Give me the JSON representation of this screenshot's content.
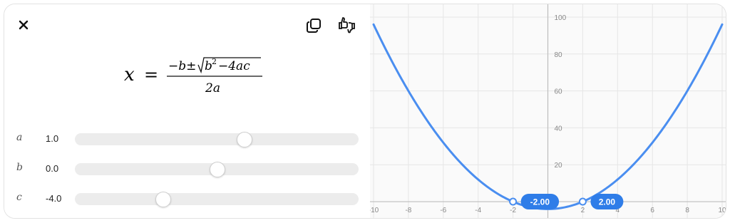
{
  "toolbar": {
    "close_icon": "close-icon",
    "copy_icon": "copy-icon",
    "feedback_icon": "thumbs-up-down-icon"
  },
  "formula": {
    "lhs": "x",
    "eq": "=",
    "minus_b": "−b±",
    "b2": "b",
    "exp": "2",
    "rest": "−4ac",
    "den": "2a"
  },
  "sliders": [
    {
      "name": "a",
      "value_text": "1.0",
      "value": 1.0
    },
    {
      "name": "b",
      "value_text": "0.0",
      "value": 0.0
    },
    {
      "name": "c",
      "value_text": "-4.0",
      "value": -4.0
    }
  ],
  "colors": {
    "curve": "#4a8ef0",
    "pill": "#2f7de8"
  },
  "chart_data": {
    "type": "line",
    "x_ticks": [
      "-10",
      "-8",
      "-6",
      "-4",
      "-2",
      "0",
      "2",
      "4",
      "6",
      "8",
      "10"
    ],
    "y_ticks": [
      "20",
      "40",
      "60",
      "80",
      "100"
    ],
    "xlim": [
      -10,
      10
    ],
    "ylim": [
      -5,
      105
    ],
    "equation": "y = ax^2 + bx + c",
    "roots": [
      {
        "x": -2,
        "label": "-2.00"
      },
      {
        "x": 2,
        "label": "2.00"
      }
    ],
    "grid": true
  }
}
